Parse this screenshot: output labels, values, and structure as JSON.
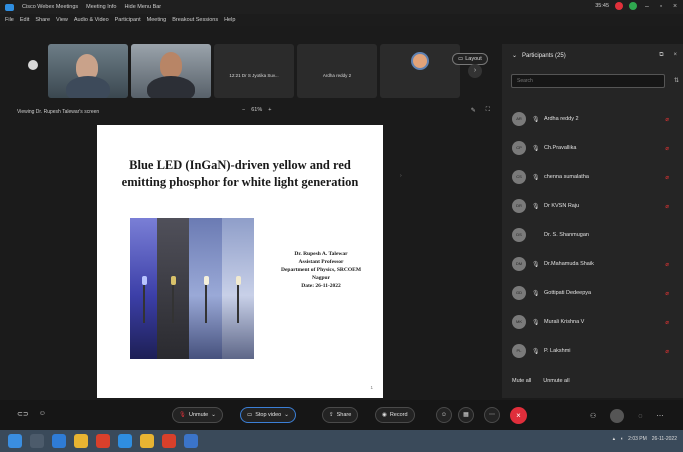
{
  "titlebar": {
    "items": [
      "Cisco Webex Meetings",
      "Meeting Info",
      "Hide Menu Bar"
    ],
    "time": "35:45",
    "indicator_colors": [
      "#e0313b",
      "#2fa84f"
    ],
    "window_controls": [
      "minimize",
      "maximize",
      "close"
    ]
  },
  "menubar": {
    "items": [
      "File",
      "Edit",
      "Share",
      "View",
      "Audio & Video",
      "Participant",
      "Meeting",
      "Breakout Sessions",
      "Help"
    ]
  },
  "videos": {
    "tiles": [
      {
        "type": "video",
        "label": ""
      },
      {
        "type": "video",
        "label": ""
      },
      {
        "type": "name",
        "label": "12:21 Dr S Jyotika Suv..."
      },
      {
        "type": "name",
        "label": "Ardha reddy 2"
      },
      {
        "type": "avatar",
        "label": ""
      }
    ],
    "layout_label": "Layout"
  },
  "viewing": {
    "text": "Viewing Dr. Rupesh Talewar's screen",
    "zoom": "61%",
    "zoom_out": "−",
    "zoom_in": "+"
  },
  "slide": {
    "title_line1": "Blue LED (InGaN)-driven yellow and red",
    "title_line2": "emitting phosphor for white light generation",
    "author_lines": [
      "Dr. Rupesh A. Talewar",
      "Assistant Professor",
      "Department of Physics, SRCOEM",
      "Nagpur",
      "Date: 26-11-2022"
    ],
    "slide_number": "1"
  },
  "participants": {
    "title": "Participants (25)",
    "search_placeholder": "Search",
    "list": [
      {
        "name": "Ardha reddy 2",
        "initials": "AR"
      },
      {
        "name": "Ch.Pravallika",
        "initials": "CP"
      },
      {
        "name": "chenna sumalatha",
        "initials": "CS"
      },
      {
        "name": "Dr KVSN Raju",
        "initials": "DR"
      },
      {
        "name": "Dr. S. Shanmugan",
        "initials": "DS"
      },
      {
        "name": "Dr.Mahamuda Shaik",
        "initials": "DM"
      },
      {
        "name": "Gottipati Dedeepya",
        "initials": "GD"
      },
      {
        "name": "Murali Krishna V",
        "initials": "MK"
      },
      {
        "name": "P. Lakshmi",
        "initials": "PL"
      }
    ],
    "footer": [
      "Mute all",
      "Unmute all"
    ]
  },
  "controls": {
    "unmute": "Unmute",
    "stop_video": "Stop video",
    "share": "Share",
    "record": "Record",
    "leave_color": "#e02e3b"
  },
  "taskbar": {
    "time": "2:03 PM",
    "date": "26-11-2022"
  }
}
